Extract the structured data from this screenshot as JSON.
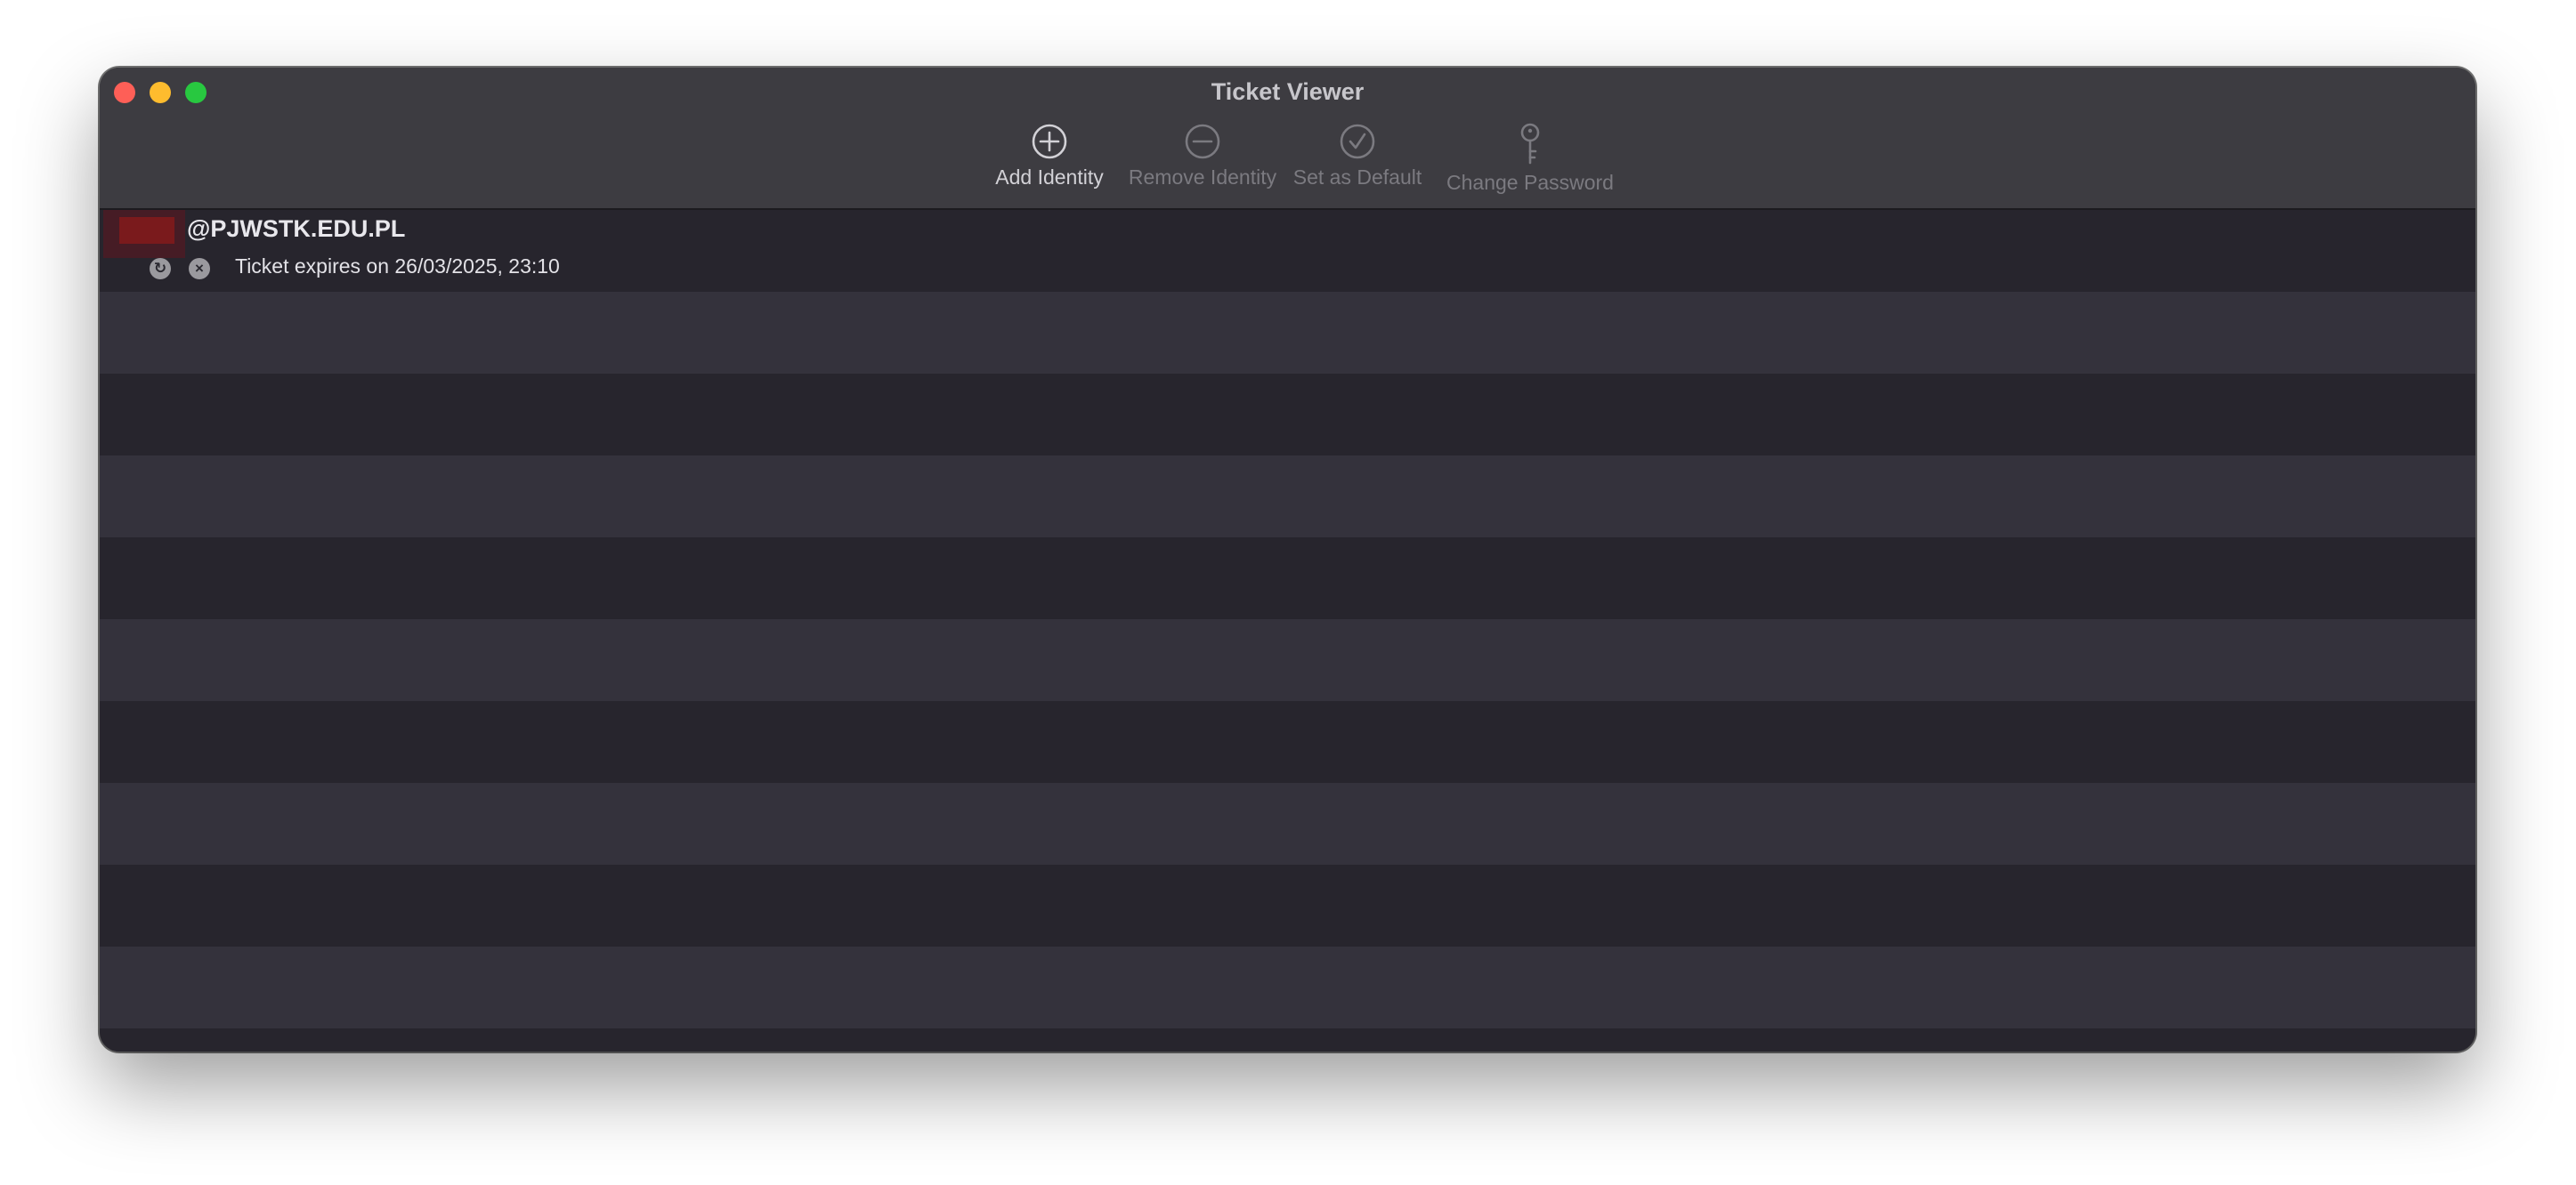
{
  "window": {
    "title": "Ticket Viewer"
  },
  "toolbar": {
    "items": [
      {
        "label": "Add Identity",
        "icon": "plus-circle-icon",
        "enabled": true
      },
      {
        "label": "Remove Identity",
        "icon": "minus-circle-icon",
        "enabled": false
      },
      {
        "label": "Set as Default",
        "icon": "checkmark-circle-icon",
        "enabled": false
      },
      {
        "label": "Change Password",
        "icon": "key-icon",
        "enabled": false
      }
    ]
  },
  "identities": [
    {
      "principal": "@PJWSTK.EDU.PL",
      "ticket_status": "Ticket expires on 26/03/2025, 23:10",
      "renew_icon": "refresh-icon",
      "destroy_icon": "close-circle-icon"
    }
  ],
  "colors": {
    "close": "#fe5f57",
    "minimize": "#febc2e",
    "zoom": "#28c840",
    "row_dark": "#27252d",
    "row_light": "#34323c",
    "toolbar_bg": "#3d3c41",
    "redaction": "#7a1a1c"
  }
}
